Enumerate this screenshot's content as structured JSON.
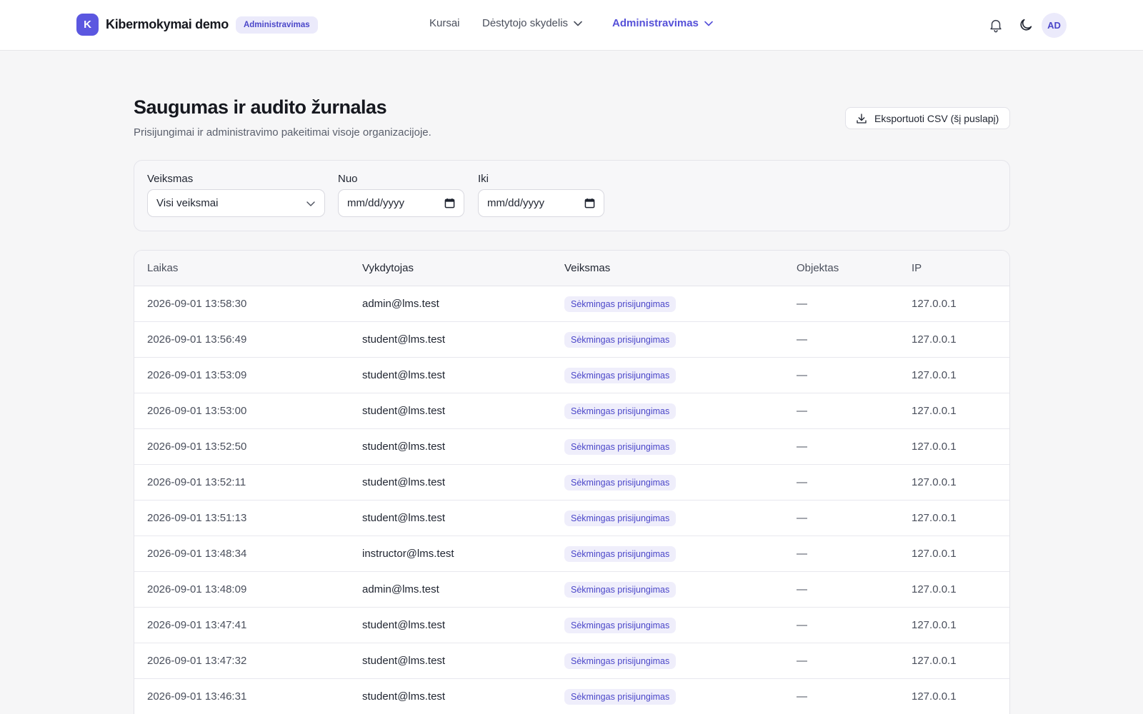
{
  "header": {
    "brand_initial": "K",
    "brand_name": "Kibermokymai demo",
    "brand_badge": "Administravimas",
    "nav": {
      "courses": "Kursai",
      "teacher": "Dėstytojo skydelis",
      "admin": "Administravimas"
    },
    "avatar": "AD"
  },
  "page": {
    "title": "Saugumas ir audito žurnalas",
    "subtitle": "Prisijungimai ir administravimo pakeitimai visoje organizacijoje.",
    "export_label": "Eksportuoti CSV (šį puslapį)"
  },
  "filters": {
    "action_label": "Veiksmas",
    "action_value": "Visi veiksmai",
    "from_label": "Nuo",
    "from_placeholder": "mm/dd/yyyy",
    "to_label": "Iki",
    "to_placeholder": "mm/dd/yyyy"
  },
  "table": {
    "headers": {
      "time": "Laikas",
      "actor": "Vykdytojas",
      "action": "Veiksmas",
      "object": "Objektas",
      "ip": "IP"
    },
    "rows": [
      {
        "time": "2026-09-01 13:58:30",
        "actor": "admin@lms.test",
        "action": "Sėkmingas prisijungimas",
        "object": "—",
        "ip": "127.0.0.1"
      },
      {
        "time": "2026-09-01 13:56:49",
        "actor": "student@lms.test",
        "action": "Sėkmingas prisijungimas",
        "object": "—",
        "ip": "127.0.0.1"
      },
      {
        "time": "2026-09-01 13:53:09",
        "actor": "student@lms.test",
        "action": "Sėkmingas prisijungimas",
        "object": "—",
        "ip": "127.0.0.1"
      },
      {
        "time": "2026-09-01 13:53:00",
        "actor": "student@lms.test",
        "action": "Sėkmingas prisijungimas",
        "object": "—",
        "ip": "127.0.0.1"
      },
      {
        "time": "2026-09-01 13:52:50",
        "actor": "student@lms.test",
        "action": "Sėkmingas prisijungimas",
        "object": "—",
        "ip": "127.0.0.1"
      },
      {
        "time": "2026-09-01 13:52:11",
        "actor": "student@lms.test",
        "action": "Sėkmingas prisijungimas",
        "object": "—",
        "ip": "127.0.0.1"
      },
      {
        "time": "2026-09-01 13:51:13",
        "actor": "student@lms.test",
        "action": "Sėkmingas prisijungimas",
        "object": "—",
        "ip": "127.0.0.1"
      },
      {
        "time": "2026-09-01 13:48:34",
        "actor": "instructor@lms.test",
        "action": "Sėkmingas prisijungimas",
        "object": "—",
        "ip": "127.0.0.1"
      },
      {
        "time": "2026-09-01 13:48:09",
        "actor": "admin@lms.test",
        "action": "Sėkmingas prisijungimas",
        "object": "—",
        "ip": "127.0.0.1"
      },
      {
        "time": "2026-09-01 13:47:41",
        "actor": "student@lms.test",
        "action": "Sėkmingas prisijungimas",
        "object": "—",
        "ip": "127.0.0.1"
      },
      {
        "time": "2026-09-01 13:47:32",
        "actor": "student@lms.test",
        "action": "Sėkmingas prisijungimas",
        "object": "—",
        "ip": "127.0.0.1"
      },
      {
        "time": "2026-09-01 13:46:31",
        "actor": "student@lms.test",
        "action": "Sėkmingas prisijungimas",
        "object": "—",
        "ip": "127.0.0.1"
      }
    ]
  },
  "colors": {
    "accent": "#5b57e0",
    "badge_bg": "#ebeafb",
    "badge_text": "#4b47c9"
  },
  "icons": {
    "bell": "bell-icon",
    "moon": "moon-icon",
    "download": "download-icon",
    "chevron": "chevron-down-icon",
    "calendar": "calendar-icon"
  }
}
